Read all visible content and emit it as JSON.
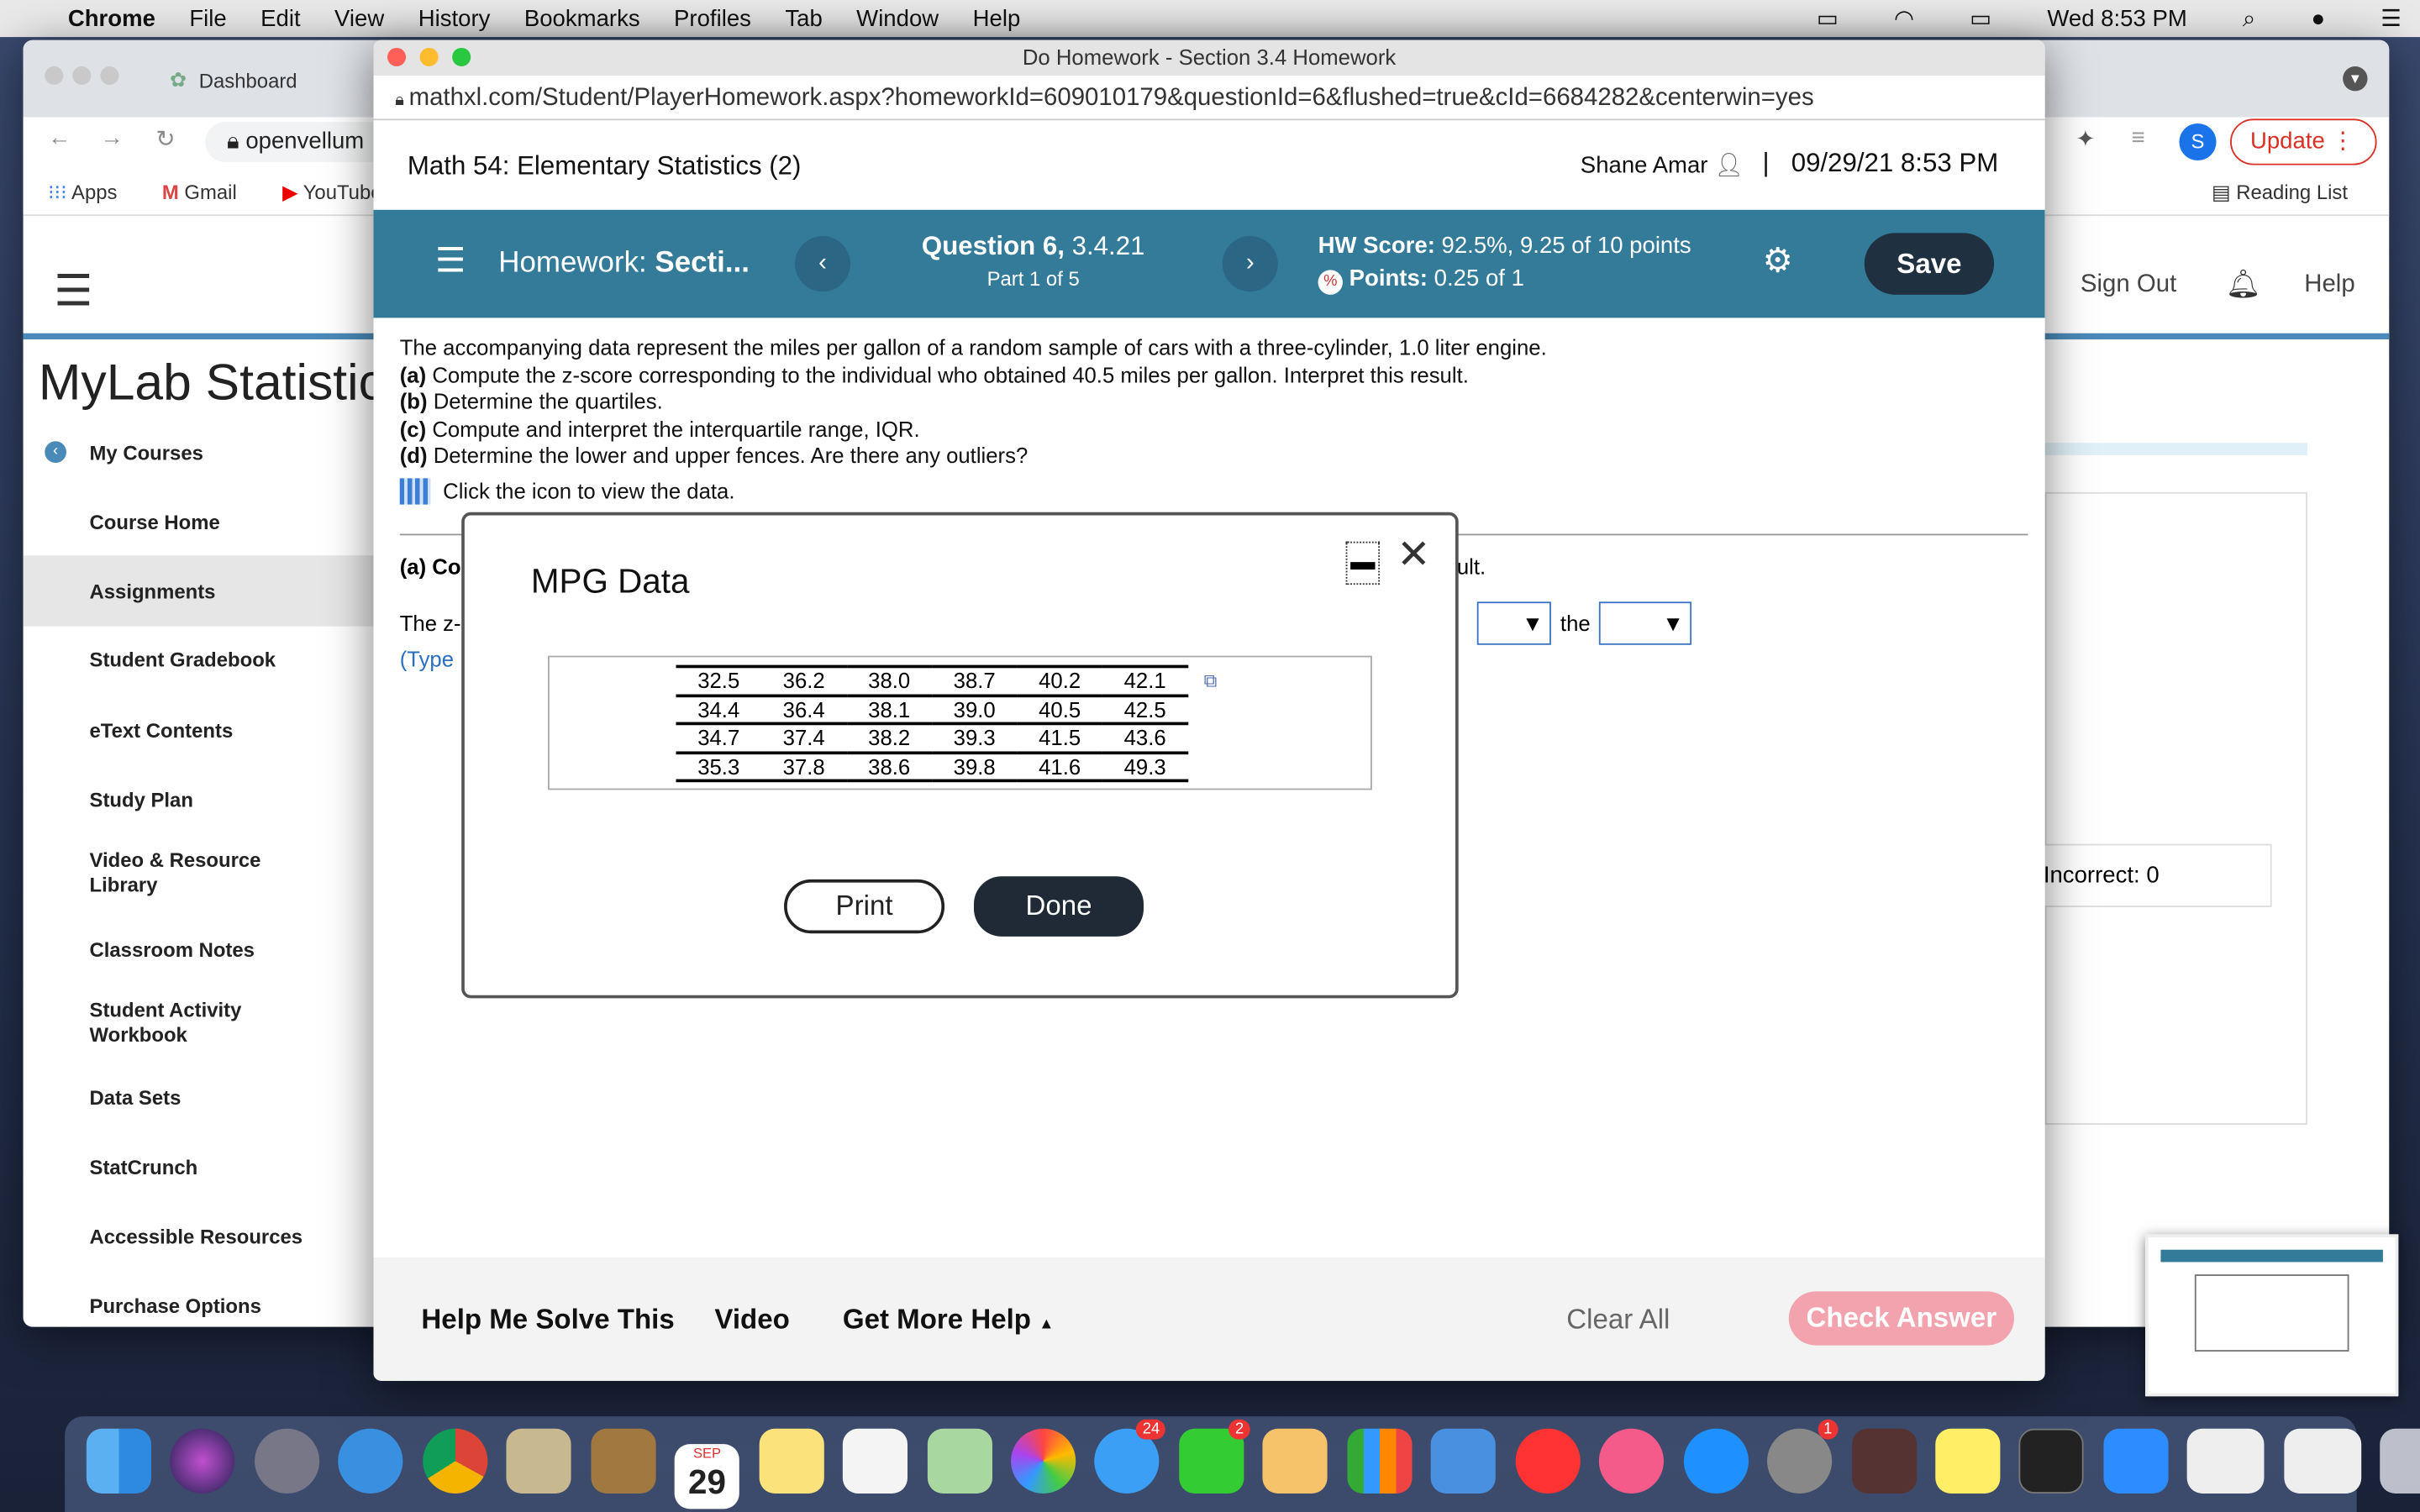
{
  "menubar": {
    "app": "Chrome",
    "items": [
      "File",
      "Edit",
      "View",
      "History",
      "Bookmarks",
      "Profiles",
      "Tab",
      "Window",
      "Help"
    ],
    "clock": "Wed 8:53 PM"
  },
  "back_window": {
    "tab_label": "Dashboard",
    "address": "openvellum",
    "bookmarks": [
      "Apps",
      "Gmail",
      "YouTube"
    ],
    "update_label": "Update",
    "profile_initial": "S",
    "reading_list": "Reading List",
    "header": {
      "sign_out": "Sign Out",
      "help": "Help"
    },
    "site_title": "MyLab Statistics",
    "sidebar": [
      "My Courses",
      "Course Home",
      "Assignments",
      "Student Gradebook",
      "eText Contents",
      "Study Plan",
      "Video & Resource Library",
      "Classroom Notes",
      "Student Activity Workbook",
      "Data Sets",
      "StatCrunch",
      "Accessible Resources",
      "Purchase Options"
    ],
    "incorrect": "Incorrect: 0"
  },
  "popup": {
    "window_title": "Do Homework - Section 3.4 Homework",
    "url": "mathxl.com/Student/PlayerHomework.aspx?homeworkId=609010179&questionId=6&flushed=true&cId=6684282&centerwin=yes",
    "course": "Math 54: Elementary Statistics (2)",
    "user": "Shane Amar",
    "datetime": "09/29/21 8:53 PM",
    "toolbar": {
      "hw_prefix": "Homework:",
      "hw_title": "Secti...",
      "question": "Question 6,",
      "question_id": "3.4.21",
      "part": "Part 1 of 5",
      "hw_score_label": "HW Score:",
      "hw_score": "92.5%, 9.25 of 10 points",
      "points_label": "Points:",
      "points": "0.25 of 1",
      "save": "Save"
    },
    "question": {
      "intro": "The accompanying data represent the miles per gallon of a random sample of cars with a three-cylinder, 1.0 liter engine.",
      "parts": [
        {
          "tag": "(a)",
          "text": "Compute the z-score corresponding to the individual who obtained 40.5 miles per gallon. Interpret this result."
        },
        {
          "tag": "(b)",
          "text": "Determine the quartiles."
        },
        {
          "tag": "(c)",
          "text": "Compute and interpret the interquartile range, IQR."
        },
        {
          "tag": "(d)",
          "text": "Determine the lower and upper fences. Are there any outliers?"
        }
      ],
      "data_link": "Click the icon to view the data.",
      "answer_a": "(a) Co",
      "answer_a_tail": "ult.",
      "answer_line": "The z-",
      "answer_the": "the",
      "type_hint": "(Type"
    },
    "footer": {
      "help_solve": "Help Me Solve This",
      "video": "Video",
      "more_help": "Get More Help",
      "clear_all": "Clear All",
      "check_answer": "Check Answer"
    }
  },
  "modal": {
    "title": "MPG Data",
    "rows": [
      [
        "32.5",
        "36.2",
        "38.0",
        "38.7",
        "40.2",
        "42.1"
      ],
      [
        "34.4",
        "36.4",
        "38.1",
        "39.0",
        "40.5",
        "42.5"
      ],
      [
        "34.7",
        "37.4",
        "38.2",
        "39.3",
        "41.5",
        "43.6"
      ],
      [
        "35.3",
        "37.8",
        "38.6",
        "39.8",
        "41.6",
        "49.3"
      ]
    ],
    "print": "Print",
    "done": "Done"
  },
  "dock": {
    "calendar_month": "SEP",
    "calendar_day": "29",
    "messages_badge": "24",
    "facetime_badge": "2",
    "sysprefs_badge": "1"
  },
  "colors": {
    "teal": "#347b99",
    "save": "#1f3140",
    "check_answer": "#f2a3ad",
    "done": "#1f2a36"
  }
}
